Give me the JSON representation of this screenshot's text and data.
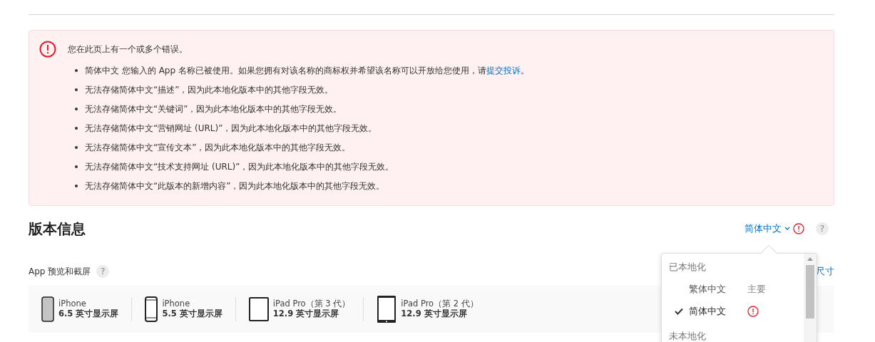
{
  "error_box": {
    "title": "您在此页上有一个或多个错误。",
    "items": [
      {
        "text": "简体中文 您输入的 App 名称已被使用。如果您拥有对该名称的商标权并希望该名称可以开放给您使用，请",
        "link": "提交投诉",
        "after": "。"
      },
      {
        "text": "无法存储简体中文“描述”，因为此本地化版本中的其他字段无效。"
      },
      {
        "text": "无法存储简体中文“关键词”，因为此本地化版本中的其他字段无效。"
      },
      {
        "text": "无法存储简体中文“营销网址 (URL)”，因为此本地化版本中的其他字段无效。"
      },
      {
        "text": "无法存储简体中文“宣传文本”，因为此本地化版本中的其他字段无效。"
      },
      {
        "text": "无法存储简体中文“技术支持网址 (URL)”，因为此本地化版本中的其他字段无效。"
      },
      {
        "text": "无法存储简体中文“此版本的新增内容”，因为此本地化版本中的其他字段无效。"
      }
    ]
  },
  "section": {
    "title": "版本信息",
    "language": "简体中文",
    "language_error": true,
    "help": "?"
  },
  "screenshots": {
    "label": "App 预览和截屏",
    "help": "?",
    "link": "尺寸",
    "devices": [
      {
        "kind": "iphone-x",
        "name": "iPhone",
        "size": "6.5 英寸显示屏",
        "selected": true
      },
      {
        "kind": "iphone",
        "name": "iPhone",
        "size": "5.5 英寸显示屏",
        "selected": false
      },
      {
        "kind": "ipad",
        "name": "iPad Pro（第 3 代）",
        "size": "12.9 英寸显示屏",
        "selected": false
      },
      {
        "kind": "ipad-old",
        "name": "iPad Pro（第 2 代）",
        "size": "12.9 英寸显示屏",
        "selected": false
      }
    ]
  },
  "language_menu": {
    "groups": [
      {
        "label": "已本地化",
        "items": [
          {
            "label": "繁体中文",
            "note": "主要",
            "selected": false,
            "error": false
          },
          {
            "label": "简体中文",
            "selected": true,
            "error": true
          }
        ]
      },
      {
        "label": "未本地化"
      }
    ]
  }
}
